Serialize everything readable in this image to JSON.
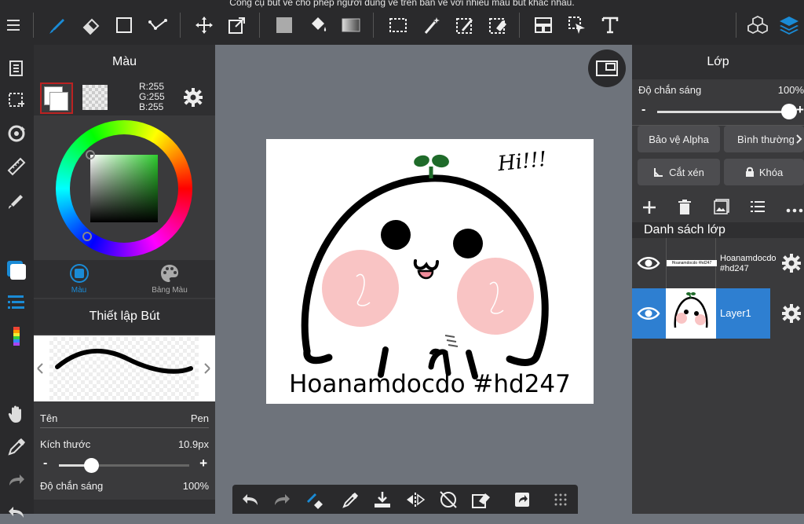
{
  "tooltip": "Công cụ bút vẽ cho phép người dùng vẽ trên bản vẽ với nhiều màu bút khác nhau.",
  "color_panel": {
    "title": "Màu",
    "rgb": {
      "r": "R:255",
      "g": "G:255",
      "b": "B:255"
    },
    "tabs": [
      {
        "label": "Màu",
        "active": true
      },
      {
        "label": "Bảng Màu",
        "active": false
      }
    ]
  },
  "brush_panel": {
    "title": "Thiết lập Bút",
    "name_label": "Tên",
    "name_value": "Pen",
    "size_label": "Kích thước",
    "size_value": "10.9px",
    "size_minus": "-",
    "size_plus": "+",
    "size_fraction": 0.25,
    "opacity_label": "Độ chắn sáng",
    "opacity_value": "100%"
  },
  "layer_panel": {
    "title": "Lớp",
    "opacity_label": "Độ chắn sáng",
    "opacity_value": "100%",
    "opacity_minus": "-",
    "opacity_plus": "+",
    "opacity_fraction": 1.0,
    "protect_alpha": "Bảo vệ Alpha",
    "blend_mode": "Bình thường",
    "clipping": "Cắt xén",
    "lock": "Khóa",
    "list_title": "Danh sách lớp",
    "layers": [
      {
        "name": "Hoanamdocdo #hd247",
        "selected": false
      },
      {
        "name": "Layer1",
        "selected": true
      }
    ]
  },
  "artwork": {
    "hi_text": "Hi!!!",
    "signature": "Hoanamdocdo #hd247",
    "thumb_text": "Hoanamdocdo #hd247"
  },
  "colors": {
    "bar": "#2a2a2c",
    "panel": "#3a3a3c",
    "accent": "#1a8bd6",
    "selected_layer": "#2e7fd1",
    "canvas_bg": "#6e737b"
  }
}
